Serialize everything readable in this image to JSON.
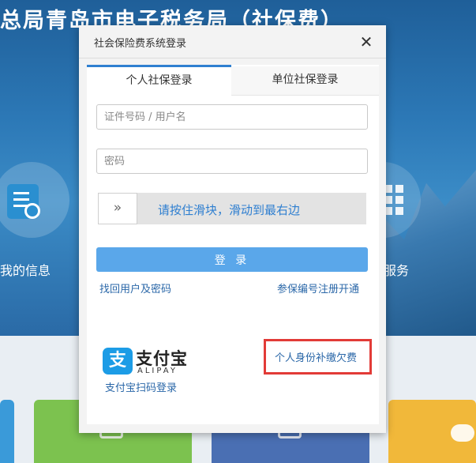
{
  "background": {
    "title": "总局青岛市电子税务局（社保费）",
    "left_tile_label": "我的信息",
    "right_tile_label": "服务"
  },
  "dialog": {
    "title": "社会保险费系统登录",
    "close_symbol": "✕",
    "tabs": [
      {
        "label": "个人社保登录",
        "active": true
      },
      {
        "label": "单位社保登录",
        "active": false
      }
    ],
    "username_placeholder": "证件号码 / 用户名",
    "password_placeholder": "密码",
    "slider": {
      "handle_symbol": "»",
      "text": "请按住滑块，滑动到最右边"
    },
    "login_label": "登 录",
    "recover_link": "找回用户及密码",
    "register_link": "参保编号注册开通",
    "alipay": {
      "logo_char": "支",
      "name_cn": "支付宝",
      "name_en": "ALIPAY",
      "scan_label": "支付宝扫码登录"
    },
    "supplement_link": "个人身份补缴欠费"
  },
  "colors": {
    "accent_blue": "#2f7fd0",
    "login_button": "#5aa7ea",
    "highlight_red": "#e23b37",
    "alipay_blue": "#1c9ce6"
  }
}
